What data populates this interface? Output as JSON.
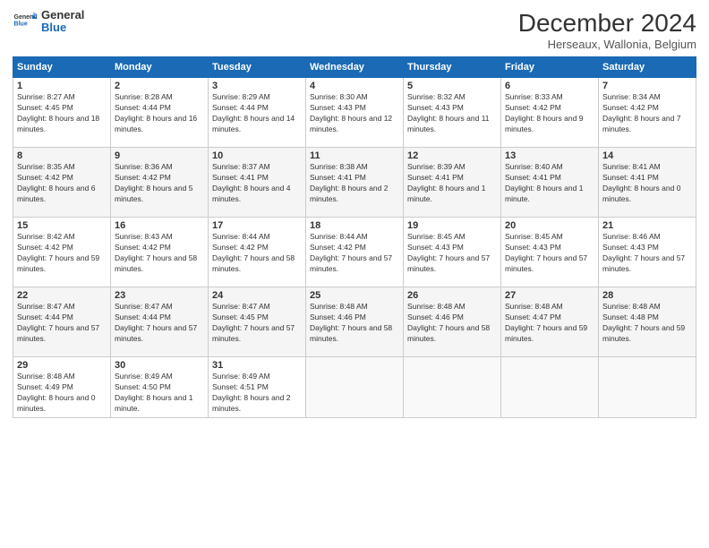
{
  "header": {
    "logo_line1": "General",
    "logo_line2": "Blue",
    "month_title": "December 2024",
    "location": "Herseaux, Wallonia, Belgium"
  },
  "days_of_week": [
    "Sunday",
    "Monday",
    "Tuesday",
    "Wednesday",
    "Thursday",
    "Friday",
    "Saturday"
  ],
  "weeks": [
    [
      {
        "day": "1",
        "sunrise": "8:27 AM",
        "sunset": "4:45 PM",
        "daylight": "8 hours and 18 minutes."
      },
      {
        "day": "2",
        "sunrise": "8:28 AM",
        "sunset": "4:44 PM",
        "daylight": "8 hours and 16 minutes."
      },
      {
        "day": "3",
        "sunrise": "8:29 AM",
        "sunset": "4:44 PM",
        "daylight": "8 hours and 14 minutes."
      },
      {
        "day": "4",
        "sunrise": "8:30 AM",
        "sunset": "4:43 PM",
        "daylight": "8 hours and 12 minutes."
      },
      {
        "day": "5",
        "sunrise": "8:32 AM",
        "sunset": "4:43 PM",
        "daylight": "8 hours and 11 minutes."
      },
      {
        "day": "6",
        "sunrise": "8:33 AM",
        "sunset": "4:42 PM",
        "daylight": "8 hours and 9 minutes."
      },
      {
        "day": "7",
        "sunrise": "8:34 AM",
        "sunset": "4:42 PM",
        "daylight": "8 hours and 7 minutes."
      }
    ],
    [
      {
        "day": "8",
        "sunrise": "8:35 AM",
        "sunset": "4:42 PM",
        "daylight": "8 hours and 6 minutes."
      },
      {
        "day": "9",
        "sunrise": "8:36 AM",
        "sunset": "4:42 PM",
        "daylight": "8 hours and 5 minutes."
      },
      {
        "day": "10",
        "sunrise": "8:37 AM",
        "sunset": "4:41 PM",
        "daylight": "8 hours and 4 minutes."
      },
      {
        "day": "11",
        "sunrise": "8:38 AM",
        "sunset": "4:41 PM",
        "daylight": "8 hours and 2 minutes."
      },
      {
        "day": "12",
        "sunrise": "8:39 AM",
        "sunset": "4:41 PM",
        "daylight": "8 hours and 1 minute."
      },
      {
        "day": "13",
        "sunrise": "8:40 AM",
        "sunset": "4:41 PM",
        "daylight": "8 hours and 1 minute."
      },
      {
        "day": "14",
        "sunrise": "8:41 AM",
        "sunset": "4:41 PM",
        "daylight": "8 hours and 0 minutes."
      }
    ],
    [
      {
        "day": "15",
        "sunrise": "8:42 AM",
        "sunset": "4:42 PM",
        "daylight": "7 hours and 59 minutes."
      },
      {
        "day": "16",
        "sunrise": "8:43 AM",
        "sunset": "4:42 PM",
        "daylight": "7 hours and 58 minutes."
      },
      {
        "day": "17",
        "sunrise": "8:44 AM",
        "sunset": "4:42 PM",
        "daylight": "7 hours and 58 minutes."
      },
      {
        "day": "18",
        "sunrise": "8:44 AM",
        "sunset": "4:42 PM",
        "daylight": "7 hours and 57 minutes."
      },
      {
        "day": "19",
        "sunrise": "8:45 AM",
        "sunset": "4:43 PM",
        "daylight": "7 hours and 57 minutes."
      },
      {
        "day": "20",
        "sunrise": "8:45 AM",
        "sunset": "4:43 PM",
        "daylight": "7 hours and 57 minutes."
      },
      {
        "day": "21",
        "sunrise": "8:46 AM",
        "sunset": "4:43 PM",
        "daylight": "7 hours and 57 minutes."
      }
    ],
    [
      {
        "day": "22",
        "sunrise": "8:47 AM",
        "sunset": "4:44 PM",
        "daylight": "7 hours and 57 minutes."
      },
      {
        "day": "23",
        "sunrise": "8:47 AM",
        "sunset": "4:44 PM",
        "daylight": "7 hours and 57 minutes."
      },
      {
        "day": "24",
        "sunrise": "8:47 AM",
        "sunset": "4:45 PM",
        "daylight": "7 hours and 57 minutes."
      },
      {
        "day": "25",
        "sunrise": "8:48 AM",
        "sunset": "4:46 PM",
        "daylight": "7 hours and 58 minutes."
      },
      {
        "day": "26",
        "sunrise": "8:48 AM",
        "sunset": "4:46 PM",
        "daylight": "7 hours and 58 minutes."
      },
      {
        "day": "27",
        "sunrise": "8:48 AM",
        "sunset": "4:47 PM",
        "daylight": "7 hours and 59 minutes."
      },
      {
        "day": "28",
        "sunrise": "8:48 AM",
        "sunset": "4:48 PM",
        "daylight": "7 hours and 59 minutes."
      }
    ],
    [
      {
        "day": "29",
        "sunrise": "8:48 AM",
        "sunset": "4:49 PM",
        "daylight": "8 hours and 0 minutes."
      },
      {
        "day": "30",
        "sunrise": "8:49 AM",
        "sunset": "4:50 PM",
        "daylight": "8 hours and 1 minute."
      },
      {
        "day": "31",
        "sunrise": "8:49 AM",
        "sunset": "4:51 PM",
        "daylight": "8 hours and 2 minutes."
      },
      null,
      null,
      null,
      null
    ]
  ]
}
